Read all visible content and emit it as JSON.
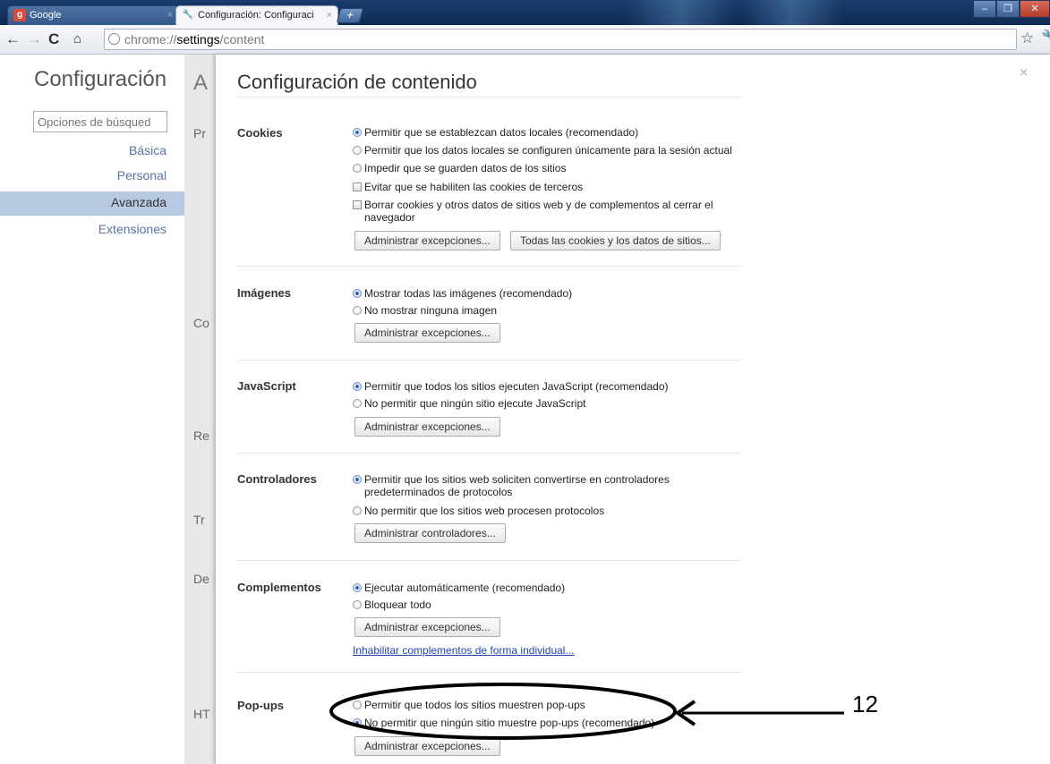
{
  "browser": {
    "tabs": [
      {
        "title": "Google",
        "active": false
      },
      {
        "title": "Configuración: Configuraci",
        "active": true
      }
    ],
    "url_scheme": "chrome://",
    "url_host": "settings",
    "url_path": "/content"
  },
  "sidebar": {
    "title": "Configuración",
    "search_placeholder": "Opciones de búsqued",
    "items": [
      {
        "label": "Básica"
      },
      {
        "label": "Personal"
      },
      {
        "label": "Avanzada",
        "selected": true
      },
      {
        "label": "Extensiones"
      }
    ]
  },
  "background_page": {
    "title_fragment": "A",
    "section_fragments": [
      "Pr",
      "Co",
      "Re",
      "Tr",
      "De",
      "HT"
    ]
  },
  "dialog": {
    "title": "Configuración de contenido",
    "close_glyph": "×",
    "sections": {
      "cookies": {
        "label": "Cookies",
        "options": [
          "Permitir que se establezcan datos locales (recomendado)",
          "Permitir que los datos locales se configuren únicamente para la sesión actual",
          "Impedir que se guarden datos de los sitios",
          "Evitar que se habiliten las cookies de terceros",
          "Borrar cookies y otros datos de sitios web y de complementos al cerrar el navegador"
        ],
        "buttons": [
          "Administrar excepciones...",
          "Todas las cookies y los datos de sitios..."
        ]
      },
      "images": {
        "label": "Imágenes",
        "options": [
          "Mostrar todas las imágenes (recomendado)",
          "No mostrar ninguna imagen"
        ],
        "button": "Administrar excepciones..."
      },
      "javascript": {
        "label": "JavaScript",
        "options": [
          "Permitir que todos los sitios ejecuten JavaScript (recomendado)",
          "No permitir que ningún sitio ejecute JavaScript"
        ],
        "button": "Administrar excepciones..."
      },
      "handlers": {
        "label": "Controladores",
        "options": [
          "Permitir que los sitios web soliciten convertirse en controladores predeterminados de protocolos",
          "No permitir que los sitios web procesen protocolos"
        ],
        "button": "Administrar controladores..."
      },
      "plugins": {
        "label": "Complementos",
        "options": [
          "Ejecutar automáticamente (recomendado)",
          "Bloquear todo"
        ],
        "button": "Administrar excepciones...",
        "link": "Inhabilitar complementos de forma individual..."
      },
      "popups": {
        "label": "Pop-ups",
        "options": [
          "Permitir que todos los sitios muestren pop-ups",
          "No permitir que ningún sitio muestre pop-ups (recomendado)"
        ],
        "button": "Administrar excepciones..."
      }
    }
  },
  "annotation": {
    "label": "12"
  }
}
